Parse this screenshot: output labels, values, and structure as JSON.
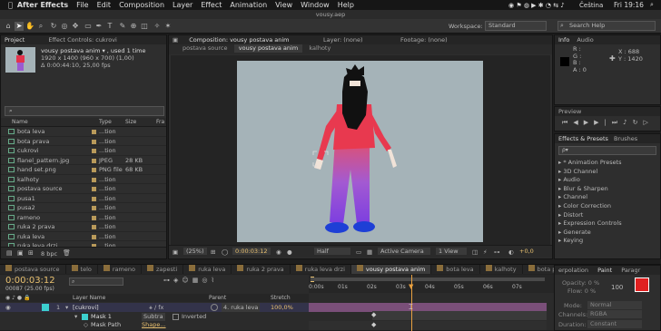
{
  "menubar": {
    "app": "After Effects",
    "items": [
      "File",
      "Edit",
      "Composition",
      "Layer",
      "Effect",
      "Animation",
      "View",
      "Window",
      "Help"
    ],
    "lang": "Čeština",
    "time": "Fri 19:16"
  },
  "window_title": "vousy.aep",
  "toolbar": {
    "workspace_label": "Workspace:",
    "workspace_value": "Standard",
    "search_placeholder": "Search Help"
  },
  "project": {
    "tabs": [
      "Project",
      "Effect Controls: cukrovi"
    ],
    "selected_name": "vousy postava anim ▾ , used 1 time",
    "dims": "1920 x 1400  (960 x 700) (1,00)",
    "duration": "Δ 0:00:44:10, 25,00 fps",
    "headers": [
      "Name",
      "Type",
      "Size",
      "Fra"
    ],
    "items": [
      {
        "name": "bota leva",
        "type": "...tion",
        "size": ""
      },
      {
        "name": "bota prava",
        "type": "...tion",
        "size": ""
      },
      {
        "name": "cukrovi",
        "type": "...tion",
        "size": ""
      },
      {
        "name": "flanel_pattern.jpg",
        "type": "JPEG",
        "size": "28 KB"
      },
      {
        "name": "hand set.png",
        "type": "PNG file",
        "size": "68 KB"
      },
      {
        "name": "kalhoty",
        "type": "...tion",
        "size": ""
      },
      {
        "name": "postava source",
        "type": "...tion",
        "size": ""
      },
      {
        "name": "pusa1",
        "type": "...tion",
        "size": ""
      },
      {
        "name": "pusa2",
        "type": "...tion",
        "size": ""
      },
      {
        "name": "rameno",
        "type": "...tion",
        "size": ""
      },
      {
        "name": "ruka 2 prava",
        "type": "...tion",
        "size": ""
      },
      {
        "name": "ruka leva",
        "type": "...tion",
        "size": ""
      },
      {
        "name": "ruka leva drzi",
        "type": "...tion",
        "size": ""
      }
    ],
    "bpc": "8 bpc"
  },
  "comp": {
    "tab_comp": "Composition: vousy postava anim",
    "tab_layer": "Layer: (none)",
    "tab_footage": "Footage: (none)",
    "sub_tabs": [
      "postava source",
      "vousy postava anim",
      "kalhoty"
    ],
    "bottom": {
      "zoom": "(25%)",
      "timecode": "0:00:03:12",
      "res": "Half",
      "camera": "Active Camera",
      "view": "1 View",
      "exposure": "+0,0"
    }
  },
  "info": {
    "tabs": [
      "Info",
      "Audio"
    ],
    "r": "R :",
    "g": "G :",
    "b": "B :",
    "a": "A : 0",
    "x": "X : 688",
    "y": "Y : 1420"
  },
  "preview": {
    "tab": "Preview"
  },
  "effects": {
    "tabs": [
      "Effects & Presets",
      "Brushes"
    ],
    "search_placeholder": "ρ▾",
    "items": [
      "* Animation Presets",
      "3D Channel",
      "Audio",
      "Blur & Sharpen",
      "Channel",
      "Color Correction",
      "Distort",
      "Expression Controls",
      "Generate",
      "Keying"
    ]
  },
  "timeline": {
    "tabs": [
      "postava source",
      "telo",
      "rameno",
      "zapesti",
      "ruka leva",
      "ruka 2 prava",
      "ruka leva drzi",
      "vousy postava anim",
      "bota leva",
      "kalhoty",
      "bota prava"
    ],
    "timecode": "0:00:03:12",
    "frames": "00087 (25.00 fps)",
    "headers": {
      "layer": "Layer Name",
      "parent": "Parent",
      "stretch": "Stretch"
    },
    "ruler": [
      "0:00s",
      "01s",
      "02s",
      "03s",
      "04s",
      "05s",
      "06s",
      "07s"
    ],
    "layers": [
      {
        "num": "1",
        "name": "[cukrovi]",
        "parent": "4. ruka leva",
        "stretch": "100,0%"
      },
      {
        "num": "",
        "name": "Mask 1",
        "mode": "Subtra",
        "inv": "Inverted",
        "parent": "",
        "stretch": ""
      },
      {
        "num": "",
        "name": "Mask Path",
        "value": "Shape...",
        "parent": "",
        "stretch": ""
      }
    ]
  },
  "right_panels": {
    "tabs": [
      "erpolation",
      "Paint",
      "Paragr"
    ],
    "opacity": "Opacity: 0 %",
    "flow": "Flow: 0 %",
    "opacity_val": "100",
    "mode_label": "Mode:",
    "mode_val": "Normal",
    "channels_label": "Channels:",
    "channels_val": "RGBA",
    "duration_label": "Duration:",
    "duration_val": "Constant"
  }
}
